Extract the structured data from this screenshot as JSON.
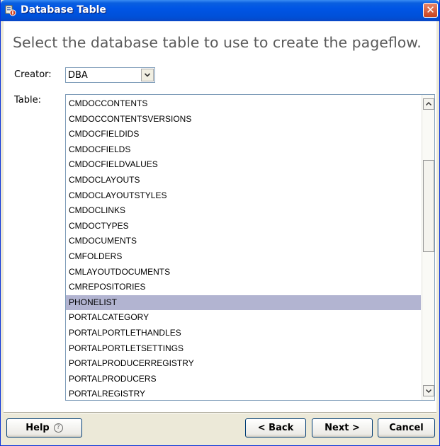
{
  "window": {
    "title": "Database Table",
    "close_glyph": "✕",
    "icon": "database-wizard-icon"
  },
  "heading": "Select the database table to use to create the pageflow.",
  "creator": {
    "label": "Creator:",
    "value": "DBA"
  },
  "table": {
    "label": "Table:",
    "items": [
      "CMDOCCONTENTS",
      "CMDOCCONTENTSVERSIONS",
      "CMDOCFIELDIDS",
      "CMDOCFIELDS",
      "CMDOCFIELDVALUES",
      "CMDOCLAYOUTS",
      "CMDOCLAYOUTSTYLES",
      "CMDOCLINKS",
      "CMDOCTYPES",
      "CMDOCUMENTS",
      "CMFOLDERS",
      "CMLAYOUTDOCUMENTS",
      "CMREPOSITORIES",
      "PHONELIST",
      "PORTALCATEGORY",
      "PORTALPORTLETHANDLES",
      "PORTALPORTLETSETTINGS",
      "PORTALPRODUCERREGISTRY",
      "PORTALPRODUCERS",
      "PORTALREGISTRY"
    ],
    "selected": "PHONELIST"
  },
  "buttons": {
    "help": "Help",
    "help_glyph": "?",
    "back": "< Back",
    "next": "Next >",
    "cancel": "Cancel"
  },
  "colors": {
    "titlebar": "#0055e5",
    "selection": "#b2b4d1",
    "heading_text": "#5a5a5a"
  }
}
